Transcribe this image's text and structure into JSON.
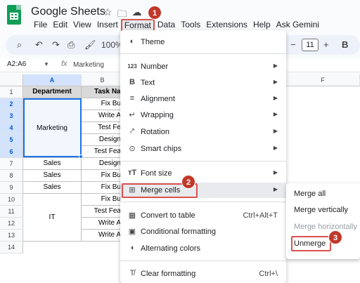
{
  "app": {
    "title": "Google Sheets",
    "menu": [
      "File",
      "Edit",
      "View",
      "Insert",
      "Format",
      "Data",
      "Tools",
      "Extensions",
      "Help",
      "Ask Gemini"
    ],
    "active_menu": "Format"
  },
  "toolbar": {
    "zoom": "100%",
    "font_size": "11",
    "minus": "−",
    "plus": "+",
    "bold": "B"
  },
  "formula_bar": {
    "name_box": "A2:A6",
    "fx": "fx",
    "value": "Marketing"
  },
  "sheet": {
    "columns": [
      "A",
      "B",
      "F"
    ],
    "rows": [
      "1",
      "2",
      "3",
      "4",
      "5",
      "6",
      "7",
      "8",
      "9",
      "10",
      "11",
      "12",
      "13",
      "14"
    ],
    "header": {
      "a": "Department",
      "b": "Task Na"
    },
    "col_a": {
      "marketing": "Marketing",
      "sales": "Sales",
      "it": "IT"
    },
    "col_b": [
      "Fix Bu",
      "Write A",
      "Test Fe",
      "Design",
      "Test Fea",
      "Design",
      "Fix Bu",
      "Fix Bu",
      "Fix Bu",
      "Test Fea",
      "Write A",
      "Write A"
    ]
  },
  "format_menu": {
    "items": [
      {
        "label": "Theme",
        "icon": "palette-icon"
      },
      {
        "label": "Number",
        "icon": "number-icon",
        "submenu": true
      },
      {
        "label": "Text",
        "icon": "bold-icon",
        "submenu": true
      },
      {
        "label": "Alignment",
        "icon": "align-icon",
        "submenu": true
      },
      {
        "label": "Wrapping",
        "icon": "wrap-icon",
        "submenu": true
      },
      {
        "label": "Rotation",
        "icon": "rotation-icon",
        "submenu": true
      },
      {
        "label": "Smart chips",
        "icon": "chip-icon",
        "submenu": true
      },
      {
        "label": "Font size",
        "icon": "font-size-icon",
        "submenu": true
      },
      {
        "label": "Merge cells",
        "icon": "merge-icon",
        "submenu": true
      },
      {
        "label": "Convert to table",
        "icon": "table-icon",
        "shortcut": "Ctrl+Alt+T"
      },
      {
        "label": "Conditional formatting",
        "icon": "conditional-icon"
      },
      {
        "label": "Alternating colors",
        "icon": "droplet-icon"
      },
      {
        "label": "Clear formatting",
        "icon": "clear-format-icon",
        "shortcut": "Ctrl+\\"
      }
    ]
  },
  "merge_submenu": {
    "items": [
      {
        "label": "Merge all",
        "disabled": false
      },
      {
        "label": "Merge vertically",
        "disabled": false
      },
      {
        "label": "Merge horizontally",
        "disabled": true
      },
      {
        "label": "Unmerge",
        "disabled": false
      }
    ]
  },
  "steps": [
    "1",
    "2",
    "3"
  ],
  "colors": {
    "accent": "#1a73e8",
    "highlight": "#d9534f",
    "badge": "#c0392b",
    "header_fill": "#d9d9d9"
  }
}
